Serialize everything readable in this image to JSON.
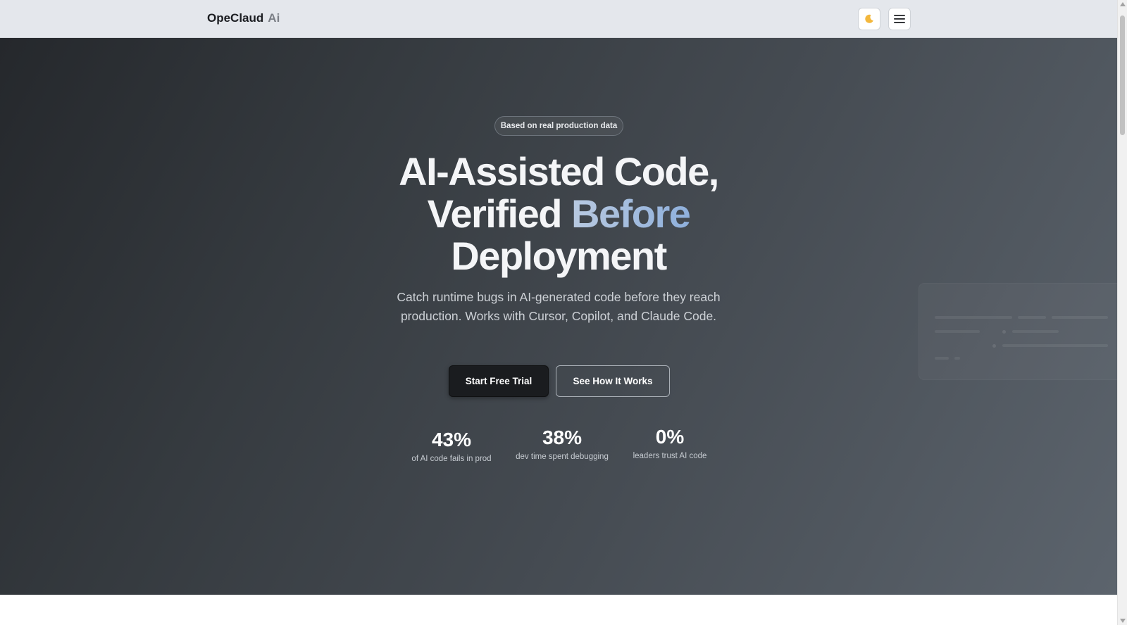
{
  "navbar": {
    "brand_name": "OpeClaud",
    "brand_suffix": "Ai",
    "theme_toggle_icon": "moon-icon",
    "menu_icon": "hamburger-menu-icon"
  },
  "hero": {
    "badge": "Based on real production data",
    "headline": {
      "line1": "AI-Assisted Code,",
      "line2_plain": "Verified",
      "line2_accent": "Before",
      "line3": "Deployment"
    },
    "subtext": "Catch runtime bugs in AI-generated code before they reach production. Works with Cursor, Copilot, and Claude Code.",
    "primary_button": "Start Free Trial",
    "secondary_button": "See How It Works",
    "stats": [
      {
        "value": "43%",
        "label": "of AI code fails in prod"
      },
      {
        "value": "38%",
        "label": "dev time spent debugging"
      },
      {
        "value": "0%",
        "label": "leaders trust AI code"
      }
    ]
  },
  "colors": {
    "accent_gradient_start": "#b8c9e0",
    "accent_gradient_end": "#8fb0dc",
    "hero_dark": "#25282c",
    "hero_light": "#5c646d",
    "primary_button_bg": "#1a1c1f"
  }
}
